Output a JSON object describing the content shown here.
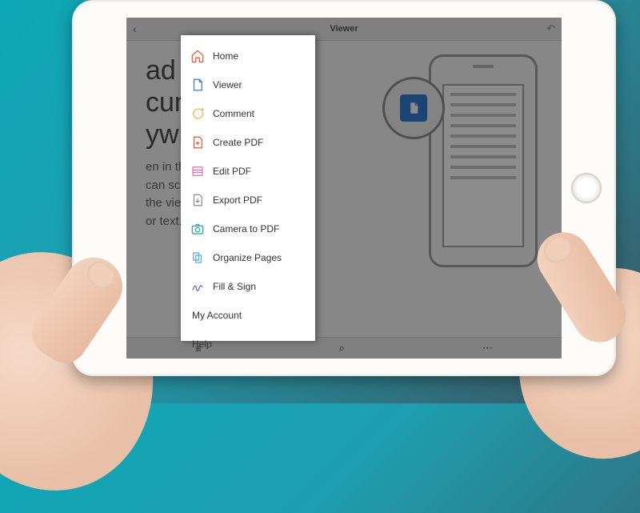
{
  "topbar": {
    "title": "Viewer"
  },
  "hero": {
    "line1": "ad",
    "line2": "cuments",
    "line3": "ywhere",
    "body1": "en in the Viewer. From",
    "body2": "can scroll and zoom,",
    "body3": "the view mode, and",
    "body4": "or text."
  },
  "sidebar": {
    "items": [
      {
        "label": "Home",
        "icon": "home-icon",
        "color": "#e8532f"
      },
      {
        "label": "Viewer",
        "icon": "document-icon",
        "color": "#2f7dd1"
      },
      {
        "label": "Comment",
        "icon": "comment-icon",
        "color": "#f3b13a"
      },
      {
        "label": "Create PDF",
        "icon": "create-pdf-icon",
        "color": "#e8532f"
      },
      {
        "label": "Edit PDF",
        "icon": "edit-pdf-icon",
        "color": "#e66aa8"
      },
      {
        "label": "Export PDF",
        "icon": "export-pdf-icon",
        "color": "#8c8c8c"
      },
      {
        "label": "Camera to PDF",
        "icon": "camera-icon",
        "color": "#1aa6a0"
      },
      {
        "label": "Organize Pages",
        "icon": "organize-icon",
        "color": "#5aa7e8"
      },
      {
        "label": "Fill & Sign",
        "icon": "sign-icon",
        "color": "#6a5bd0"
      }
    ],
    "plain": [
      {
        "label": "My Account"
      },
      {
        "label": "Help"
      }
    ]
  },
  "bottombar": {
    "left": "≡",
    "mid": "⌕",
    "right": "⋯"
  }
}
